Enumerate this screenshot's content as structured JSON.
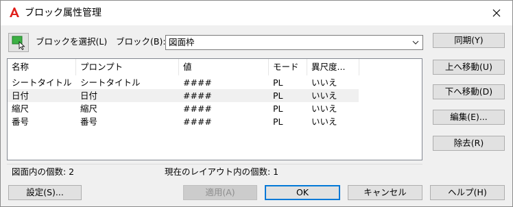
{
  "window": {
    "title": "ブロック属性管理"
  },
  "toolbar": {
    "select_block_label": "ブロックを選択(L)",
    "block_label": "ブロック(B):",
    "block_value": "図面枠"
  },
  "list": {
    "columns": [
      "名称",
      "プロンプト",
      "値",
      "モード",
      "異尺度..."
    ],
    "rows": [
      {
        "name": "シートタイトル",
        "prompt": "シートタイトル",
        "value": "####",
        "mode": "PL",
        "annotative": "いいえ"
      },
      {
        "name": "日付",
        "prompt": "日付",
        "value": "####",
        "mode": "PL",
        "annotative": "いいえ"
      },
      {
        "name": "縮尺",
        "prompt": "縮尺",
        "value": "####",
        "mode": "PL",
        "annotative": "いいえ"
      },
      {
        "name": "番号",
        "prompt": "番号",
        "value": "####",
        "mode": "PL",
        "annotative": "いいえ"
      }
    ]
  },
  "status": {
    "in_drawing": "図面内の個数: 2",
    "in_layout": "現在のレイアウト内の個数: 1"
  },
  "side_buttons": {
    "sync": "同期(Y)",
    "move_up": "上へ移動(U)",
    "move_down": "下へ移動(D)",
    "edit": "編集(E)...",
    "remove": "除去(R)"
  },
  "bottom_buttons": {
    "settings": "設定(S)...",
    "apply": "適用(A)",
    "ok": "OK",
    "cancel": "キャンセル",
    "help": "ヘルプ(H)"
  },
  "colors": {
    "app_icon": "#e0201b",
    "select_icon": "#3cb043",
    "accent": "#0078d7"
  }
}
